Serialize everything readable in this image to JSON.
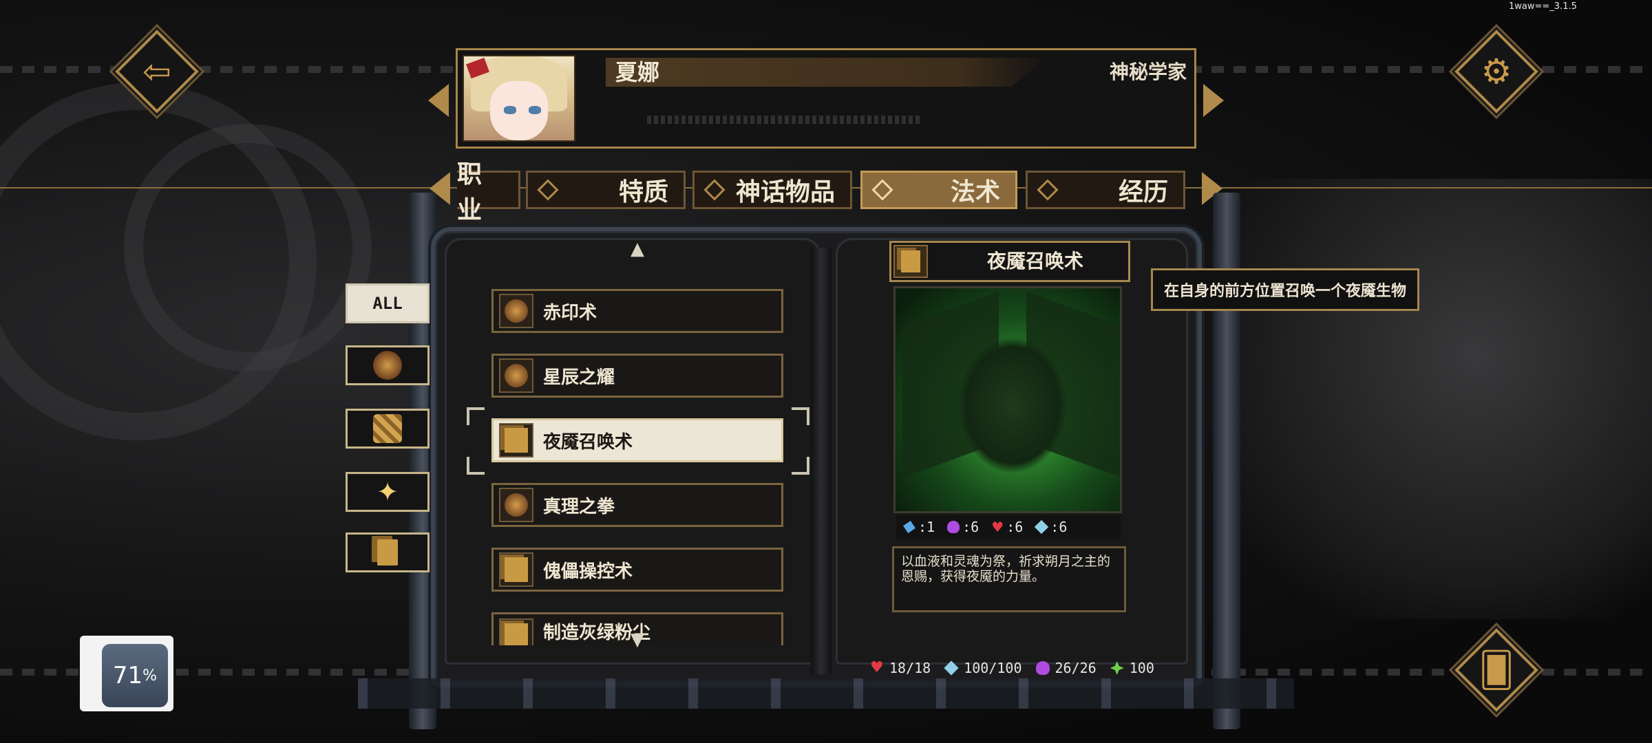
{
  "version": "1waw==_3.1.5",
  "character": {
    "name": "夏娜",
    "class": "神秘学家"
  },
  "tabs": [
    {
      "label": "职业",
      "active": false
    },
    {
      "label": "特质",
      "active": false
    },
    {
      "label": "神话物品",
      "active": false
    },
    {
      "label": "法术",
      "active": true
    },
    {
      "label": "经历",
      "active": false
    }
  ],
  "filters": {
    "all_label": "ALL"
  },
  "spells": [
    {
      "label": "赤印术",
      "icon": "skull-icon",
      "selected": false
    },
    {
      "label": "星辰之耀",
      "icon": "skull-icon",
      "selected": false
    },
    {
      "label": "夜魇召唤术",
      "icon": "cards-icon",
      "selected": true
    },
    {
      "label": "真理之拳",
      "icon": "skull-icon",
      "selected": false
    },
    {
      "label": "傀儡操控术",
      "icon": "cards-icon",
      "selected": false
    },
    {
      "label": "制造灰绿粉尘",
      "icon": "cards-icon",
      "selected": false
    }
  ],
  "card": {
    "title": "夜魇召唤术",
    "stats": [
      {
        "icon": "blue-boot-icon",
        "value": ":1"
      },
      {
        "icon": "purple-potion-icon",
        "value": ":6"
      },
      {
        "icon": "red-heart-icon",
        "value": ":6"
      },
      {
        "icon": "cyan-gem-icon",
        "value": ":6"
      }
    ],
    "description": "以血液和灵魂为祭，祈求朔月之主的恩赐，获得夜魇的力量。"
  },
  "tooltip": "在自身的前方位置召唤一个夜魇生物",
  "resources": {
    "hp": "18/18",
    "sanity": "100/100",
    "mana": "26/26",
    "luck": "100"
  },
  "battery": {
    "percent": "71",
    "unit": "%"
  },
  "colors": {
    "gold": "#b08a4a",
    "active_tab": "#8a6a3c",
    "selected_row": "#ece6d6"
  }
}
